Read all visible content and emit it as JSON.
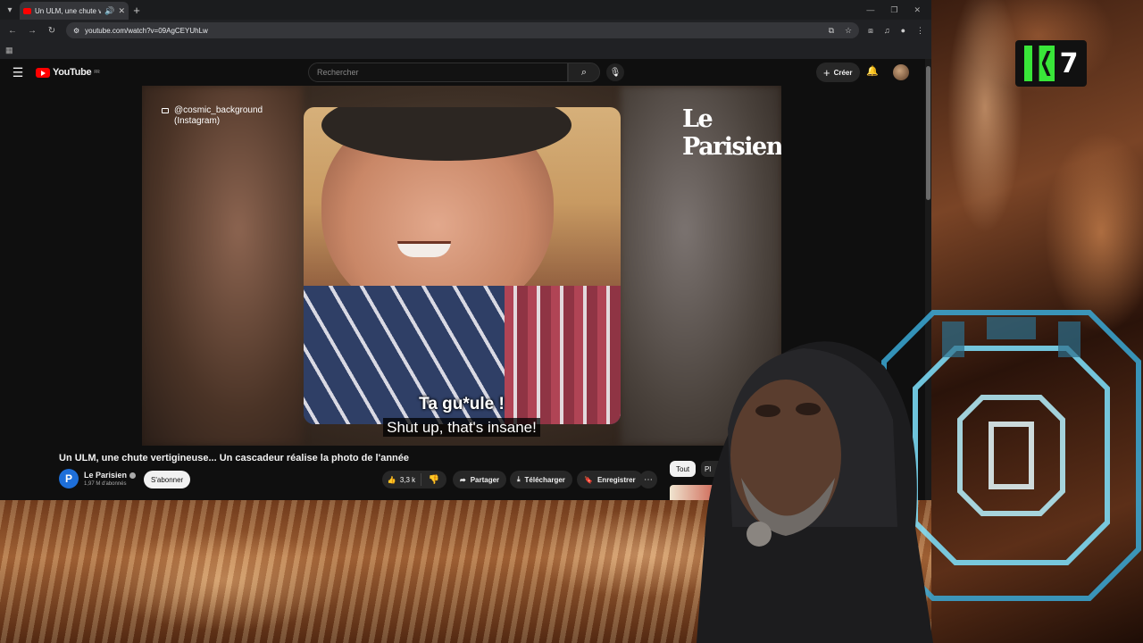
{
  "browser": {
    "tab_title": "Un ULM, une chute vertigi",
    "new_tab": "+",
    "url": "youtube.com/watch?v=09AgCEYUhLw"
  },
  "youtube": {
    "logo_text": "YouTube",
    "logo_region": "FR",
    "search_placeholder": "Rechercher",
    "create_label": "Créer"
  },
  "video": {
    "source_handle": "@cosmic_background",
    "source_platform": "(Instagram)",
    "brand": "Le Parisien",
    "subtitle_line1": "Ta gu*ule !",
    "subtitle_line2": "Shut up, that's insane!",
    "title": "Un ULM, une chute vertigineuse... Un cascadeur réalise la photo de l'année"
  },
  "channel": {
    "avatar_letter": "P",
    "name": "Le Parisien",
    "subscribers": "1,97 M d'abonnés",
    "subscribe_label": "S'abonner"
  },
  "actions": {
    "likes": "3,3 k",
    "share": "Partager",
    "download": "Télécharger",
    "save": "Enregistrer"
  },
  "chips": {
    "all": "Tout",
    "second": "Pl"
  },
  "overlay": {
    "badge_number": "7",
    "badge_color": "#39e639"
  }
}
